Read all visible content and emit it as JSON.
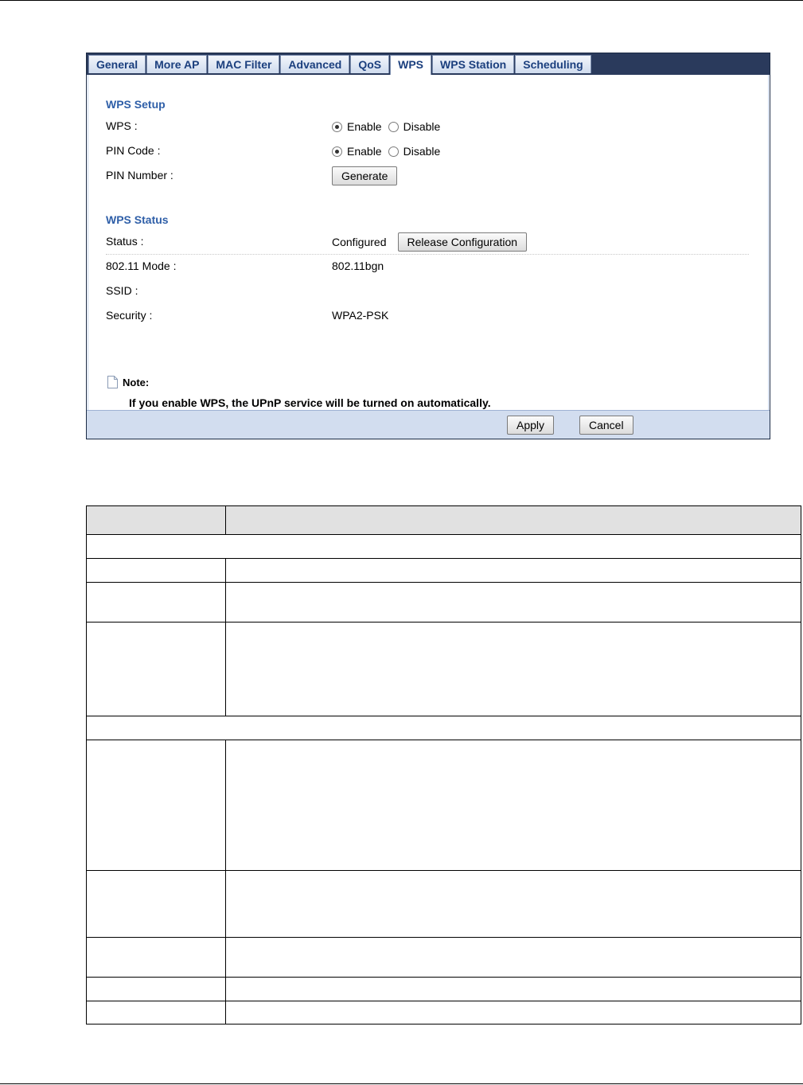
{
  "tabs": [
    {
      "label": "General",
      "active": false
    },
    {
      "label": "More AP",
      "active": false
    },
    {
      "label": "MAC Filter",
      "active": false
    },
    {
      "label": "Advanced",
      "active": false
    },
    {
      "label": "QoS",
      "active": false
    },
    {
      "label": "WPS",
      "active": true
    },
    {
      "label": "WPS Station",
      "active": false
    },
    {
      "label": "Scheduling",
      "active": false
    }
  ],
  "setup": {
    "title": "WPS Setup",
    "wps_label": "WPS :",
    "pin_code_label": "PIN Code :",
    "pin_number_label": "PIN Number :",
    "enable": "Enable",
    "disable": "Disable",
    "wps_selected": "Enable",
    "pin_code_selected": "Enable",
    "generate_button": "Generate"
  },
  "status": {
    "title": "WPS Status",
    "status_label": "Status :",
    "status_value": "Configured",
    "release_button": "Release Configuration",
    "mode_label": "802.11 Mode :",
    "mode_value": "802.11bgn",
    "ssid_label": "SSID :",
    "ssid_value": "",
    "security_label": "Security :",
    "security_value": "WPA2-PSK"
  },
  "note": {
    "title": "Note:",
    "text": "If you enable WPS, the UPnP service will be turned on automatically."
  },
  "footer": {
    "apply": "Apply",
    "cancel": "Cancel"
  },
  "colors": {
    "tabbar": "#2a3a5c",
    "section_title": "#2f5fa8",
    "footer": "#d2ddef",
    "table_header": "#e1e1e1"
  }
}
